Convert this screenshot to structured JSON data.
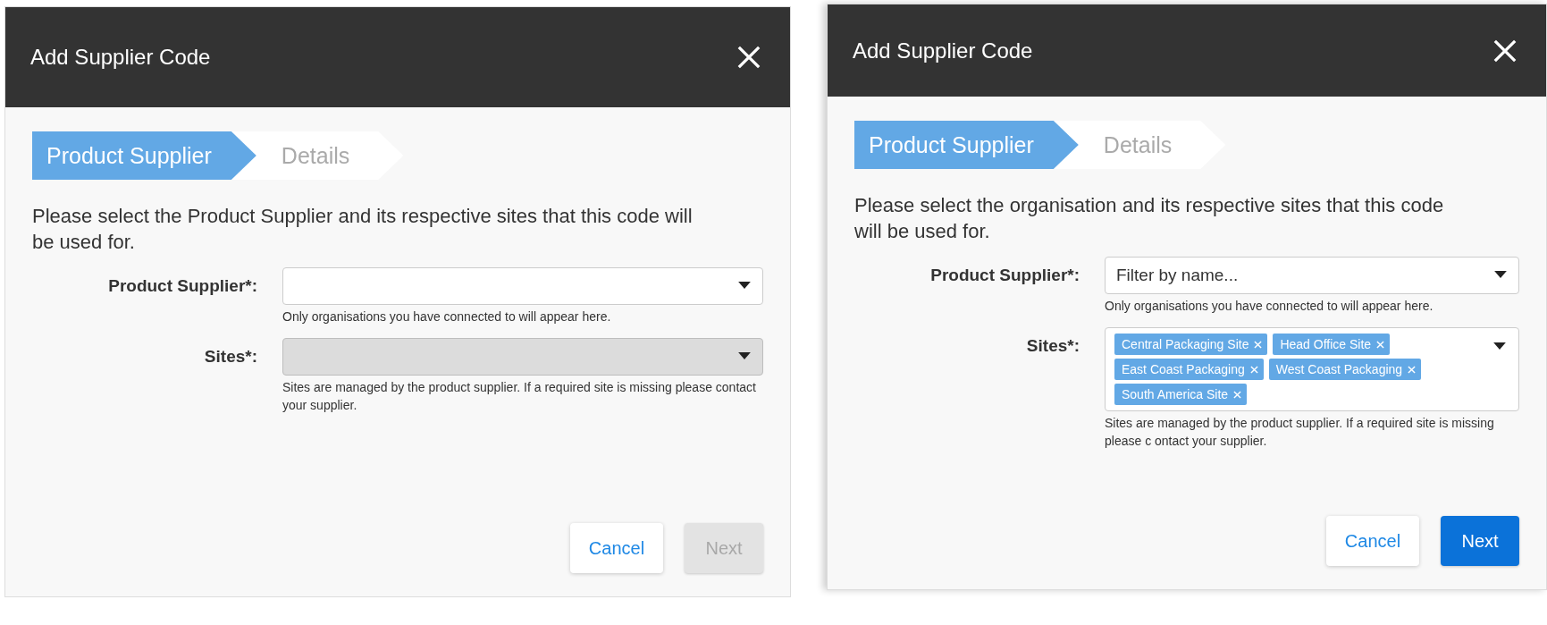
{
  "dialogs": [
    {
      "title": "Add Supplier Code",
      "steps": [
        {
          "label": "Product Supplier",
          "selected": true
        },
        {
          "label": "Details",
          "selected": false
        }
      ],
      "description": "Please select the Product Supplier and its respective sites that this code will be used for.",
      "fields": [
        {
          "label": "Product Supplier*:",
          "hint": "Only organisations you have connected to will appear here.",
          "disabled": false
        },
        {
          "label": "Sites*:",
          "hint": "Sites are managed by the product supplier. If a required site is missing please contact your supplier.",
          "disabled": true
        }
      ],
      "buttons": [
        {
          "label": "Cancel",
          "kind": "secondary"
        },
        {
          "label": "Next",
          "kind": "primary",
          "disabled": true
        }
      ]
    },
    {
      "title": "Add Supplier Code",
      "steps": [
        {
          "label": "Product Supplier",
          "selected": true
        },
        {
          "label": "Details",
          "selected": false
        }
      ],
      "description": "Please select the organisation and its  respective sites that this code will be used for.",
      "fields": [
        {
          "label": "Product Supplier*:",
          "placeholder": "Filter by name...",
          "hint": "Only organisations you have connected to will appear here.",
          "disabled": false
        },
        {
          "label": "Sites*:",
          "tags": [
            "Central Packaging Site",
            "Head Office Site",
            "East Coast Packaging",
            "West Coast Packaging",
            "South America Site"
          ],
          "hint": "Sites are managed by the product supplier. If a required site is missing please c ontact your supplier.",
          "disabled": false
        }
      ],
      "buttons": [
        {
          "label": "Cancel",
          "kind": "secondary"
        },
        {
          "label": "Next",
          "kind": "primary",
          "disabled": false
        }
      ]
    }
  ]
}
